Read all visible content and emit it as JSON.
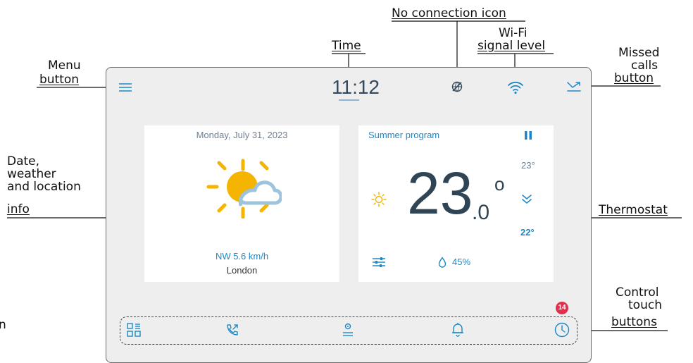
{
  "callouts": {
    "no_connection": "No connection icon",
    "time": "Time",
    "wifi_line1": "Wi-Fi",
    "wifi_line2": "signal level",
    "missed_line1": "Missed",
    "missed_line2": "calls",
    "missed_line3": "button",
    "menu_line1": "Menu",
    "menu_line2": "button",
    "date_line1": "Date,",
    "date_line2": "weather",
    "date_line3": "and location",
    "date_line4": "info",
    "thermostat": "Thermostat",
    "control_line1": "Control",
    "control_line2": "touch",
    "control_line3": "buttons",
    "cut_letter": "n"
  },
  "device": {
    "time": "11:12",
    "weather": {
      "date": "Monday, July 31, 2023",
      "wind": "NW 5.6 km/h",
      "location": "London",
      "icon": "sun-cloud-icon"
    },
    "thermostat": {
      "program": "Summer program",
      "temp_int": "23",
      "temp_dec": ".0",
      "degree": "o",
      "setpoint_high": "23°",
      "setpoint_low": "22°",
      "humidity": "45%"
    },
    "missed_calls_count": "14",
    "colors": {
      "accent": "#1e88c7",
      "sun": "#f5b400",
      "badge": "#e0304a",
      "temp": "#2f4454"
    }
  }
}
